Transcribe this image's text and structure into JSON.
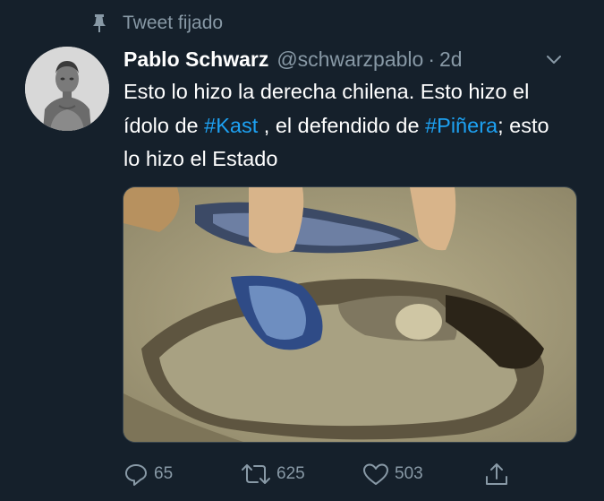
{
  "pinned": {
    "label": "Tweet fijado",
    "icon": "pin-icon"
  },
  "author": {
    "name": "Pablo Schwarz",
    "handle": "@schwarzpablo",
    "separator": "·",
    "time": "2d"
  },
  "tweet": {
    "text_1": "Esto lo hizo la derecha chilena. Esto hizo el ídolo de ",
    "hashtag_1": "#Kast",
    "text_2": " , el defendido de ",
    "hashtag_2": "#Piñera",
    "text_3": "; esto lo hizo el Estado"
  },
  "actions": {
    "replies": "65",
    "retweets": "625",
    "likes": "503"
  },
  "colors": {
    "background": "#15202b",
    "secondary_text": "#8899a6",
    "link": "#1da1f2"
  }
}
